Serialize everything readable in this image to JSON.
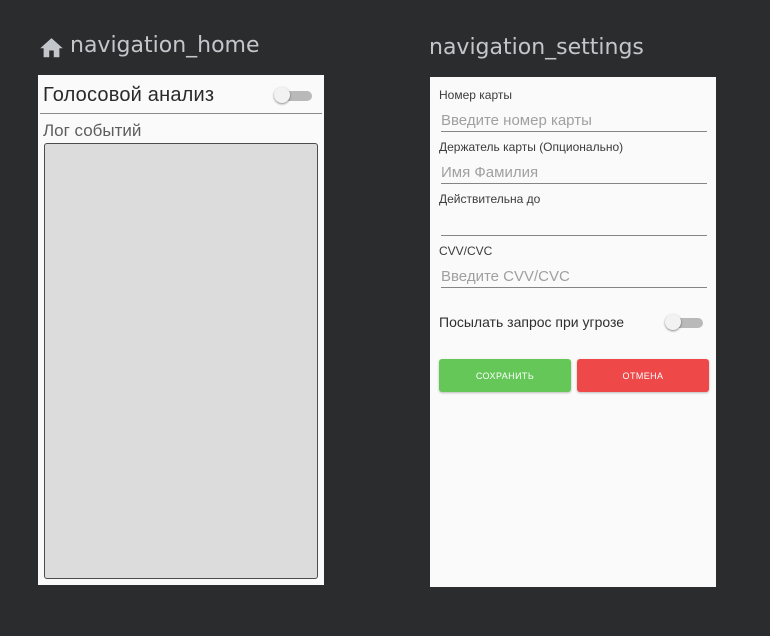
{
  "colors": {
    "canvas_background": "#2b2c2e",
    "screen_background": "#fafafa",
    "log_area_background": "#dcdcdc",
    "save_button": "#64c758",
    "cancel_button": "#ee4849",
    "title_text": "#c3c6cb"
  },
  "screens": {
    "home": {
      "title": "navigation_home",
      "title_icon": "home-icon",
      "voice_analysis_label": "Голосовой анализ",
      "voice_analysis_enabled": false,
      "log_label": "Лог событий",
      "log_content": ""
    },
    "settings": {
      "title": "navigation_settings",
      "card_number": {
        "label": "Номер карты",
        "value": "",
        "placeholder": "Введите номер карты"
      },
      "card_holder": {
        "label": "Держатель карты (Опционально)",
        "value": "",
        "placeholder": "Имя Фамилия"
      },
      "valid_until": {
        "label": "Действительна до",
        "value": "",
        "placeholder": ""
      },
      "cvv": {
        "label": "CVV/CVC",
        "value": "",
        "placeholder": "Введите CVV/CVC"
      },
      "send_on_threat": {
        "label": "Посылать запрос при угрозе",
        "enabled": false
      },
      "save_button_label": "СОХРАНИТЬ",
      "cancel_button_label": "ОТМЕНА"
    }
  }
}
